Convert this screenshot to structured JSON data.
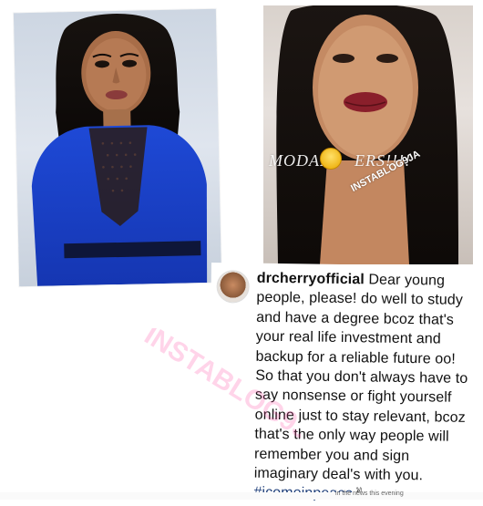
{
  "left_photo": {
    "alt": "Woman in blue dress with sheer neckline"
  },
  "right_photo": {
    "overlay_text": "MODAF",
    "overlay_text_2": "ERS!!!!",
    "sticker": "INSTABLOG9JA"
  },
  "comment": {
    "username": "drcherryofficial",
    "body": "Dear young people, please! do well to study and have a degree bcoz that's your real life investment and backup for a reliable future oo! So that you don't always have to say nonsense or fight yourself online just to stay relevant, bcoz that's the only way people will remember you and sign imaginary deal's with you.",
    "hashtag": "#icomeinpeace",
    "emoji": "✌"
  },
  "watermark": "INSTABLOG9JA",
  "caption_fragment": "in the news this evening"
}
